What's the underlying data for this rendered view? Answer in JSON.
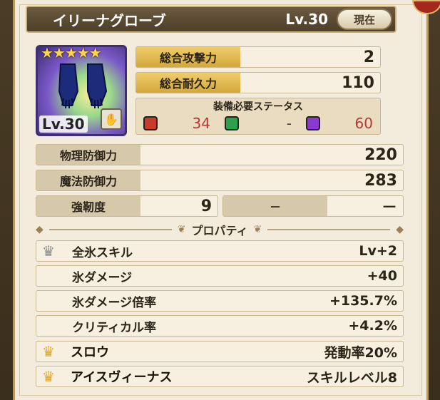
{
  "header": {
    "item_name": "イリーナグローブ",
    "level": "Lv.30",
    "now_button": "現在"
  },
  "icon": {
    "stars": "★★★★★",
    "level_badge": "Lv.30",
    "gloves_icon": "gloves-icon"
  },
  "stats": {
    "total_attack": {
      "label": "総合攻撃力",
      "value": "2"
    },
    "total_durability": {
      "label": "総合耐久力",
      "value": "110"
    }
  },
  "requirements": {
    "title": "装備必要ステータス",
    "str": "34",
    "dex": "-",
    "mag": "60"
  },
  "defense": {
    "physical": {
      "label": "物理防御力",
      "value": "220"
    },
    "magic": {
      "label": "魔法防御力",
      "value": "283"
    },
    "toughness": {
      "label": "強靭度",
      "value": "9"
    },
    "blank_label": "－",
    "blank_value": "－"
  },
  "properties_title": "プロパティ",
  "properties": [
    {
      "label": "全氷スキル",
      "value": "Lv+2",
      "icon": "silver-crown-icon"
    },
    {
      "label": "氷ダメージ",
      "value": "+40",
      "icon": ""
    },
    {
      "label": "氷ダメージ倍率",
      "value": "+135.7%",
      "icon": ""
    },
    {
      "label": "クリティカル率",
      "value": "+4.2%",
      "icon": ""
    },
    {
      "label": "スロウ",
      "value": "発動率20%",
      "icon": "gold-crown-icon"
    },
    {
      "label": "アイスヴィーナス",
      "value": "スキルレベル8",
      "icon": "gold-crown-icon"
    }
  ]
}
